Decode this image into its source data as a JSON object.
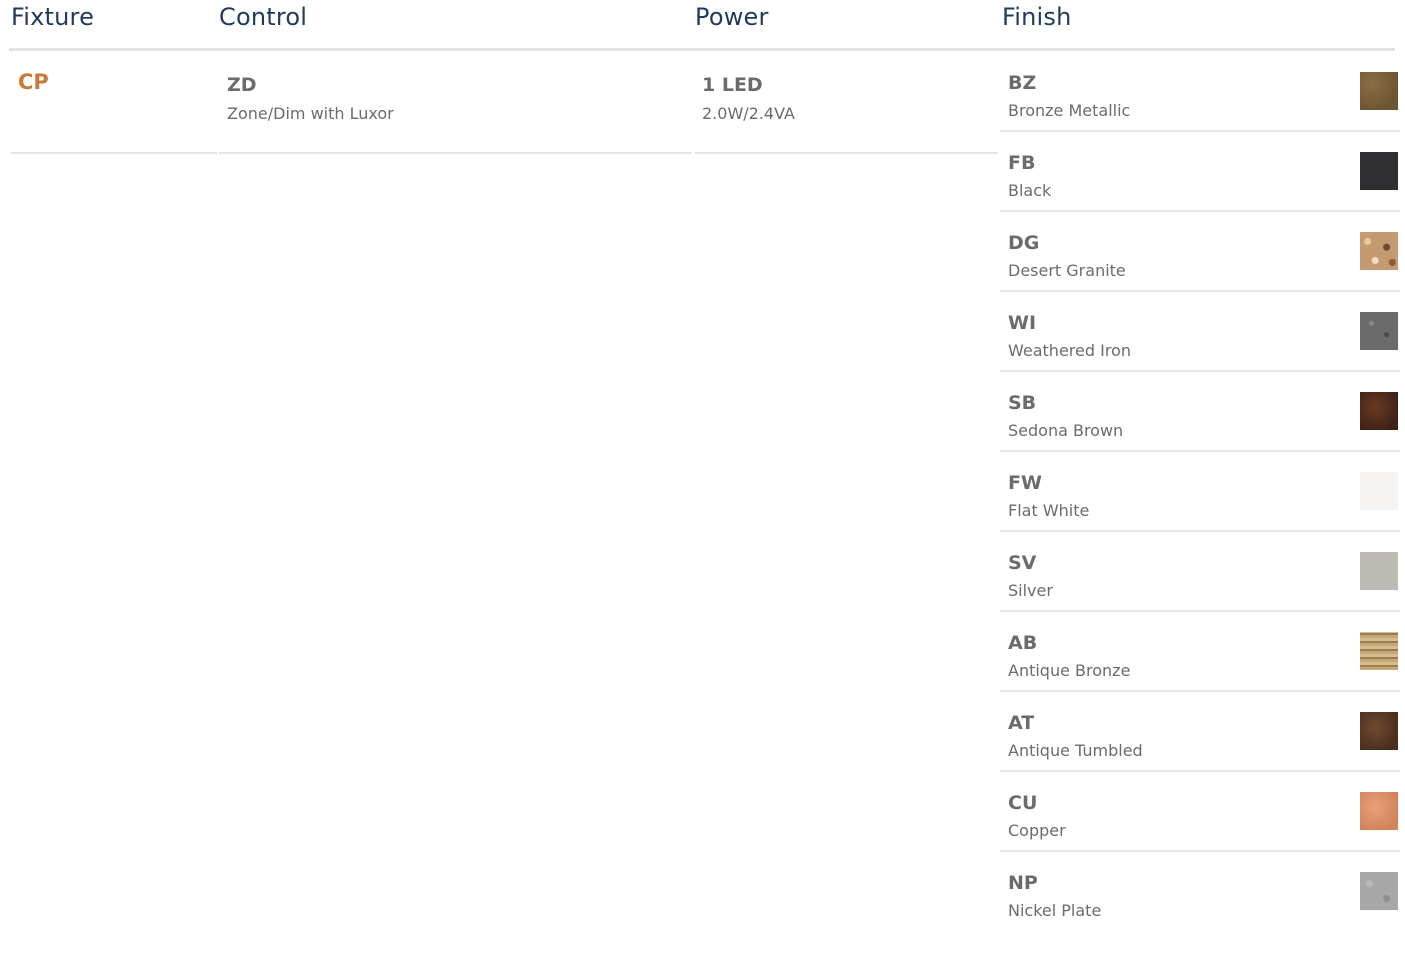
{
  "headers": {
    "fixture": "Fixture",
    "control": "Control",
    "power": "Power",
    "finish": "Finish"
  },
  "fixture": {
    "code": "CP"
  },
  "control": {
    "code": "ZD",
    "desc": "Zone/Dim with Luxor"
  },
  "power": {
    "code": "1 LED",
    "desc": "2.0W/2.4VA"
  },
  "finishes": [
    {
      "code": "BZ",
      "name": "Bronze Metallic"
    },
    {
      "code": "FB",
      "name": "Black"
    },
    {
      "code": "DG",
      "name": "Desert Granite"
    },
    {
      "code": "WI",
      "name": "Weathered Iron"
    },
    {
      "code": "SB",
      "name": "Sedona Brown"
    },
    {
      "code": "FW",
      "name": "Flat White"
    },
    {
      "code": "SV",
      "name": "Silver"
    },
    {
      "code": "AB",
      "name": "Antique Bronze"
    },
    {
      "code": "AT",
      "name": "Antique Tumbled"
    },
    {
      "code": "CU",
      "name": "Copper"
    },
    {
      "code": "NP",
      "name": "Nickel Plate"
    }
  ],
  "colors": {
    "header_text": "#1f3a5c",
    "fixture_accent": "#c97a3a",
    "body_text": "#6b6b6b",
    "rule": "#e5e5e5"
  }
}
